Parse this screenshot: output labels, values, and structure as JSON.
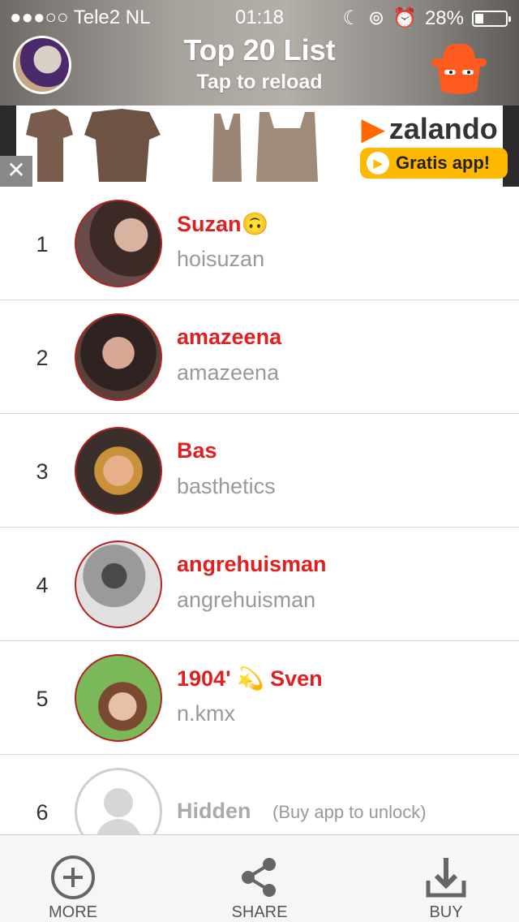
{
  "status_bar": {
    "carrier": "●●●○○ Tele2 NL",
    "time": "01:18",
    "battery": "28%",
    "battery_level": 0.28
  },
  "header": {
    "title": "Top 20 List",
    "subtitle": "Tap to reload",
    "left_icon": "profile-avatar",
    "right_icon": "spy-hat-icon"
  },
  "ad": {
    "brand": "zalando",
    "cta": "Gratis app!",
    "close_symbol": "✕"
  },
  "list": [
    {
      "rank": "1",
      "name": "Suzan🙃",
      "username": "hoisuzan",
      "avatar_color": "#7a5a4a"
    },
    {
      "rank": "2",
      "name": "amazeena",
      "username": "amazeena",
      "avatar_color": "#5a3e33"
    },
    {
      "rank": "3",
      "name": "Bas",
      "username": "basthetics",
      "avatar_color": "#b07a4a"
    },
    {
      "rank": "4",
      "name": "angrehuisman",
      "username": "angrehuisman",
      "avatar_color": "#cfcfcf"
    },
    {
      "rank": "5",
      "name": "1904' 💫 Sven",
      "username": "n.kmx",
      "avatar_color": "#6aa64a"
    },
    {
      "rank": "6",
      "name": "Hidden",
      "note": "(Buy app to unlock)"
    }
  ],
  "tabbar": {
    "more": "MORE",
    "share": "SHARE",
    "buy": "BUY"
  },
  "colors": {
    "accent": "#e02020",
    "secondary_text": "#999999"
  }
}
